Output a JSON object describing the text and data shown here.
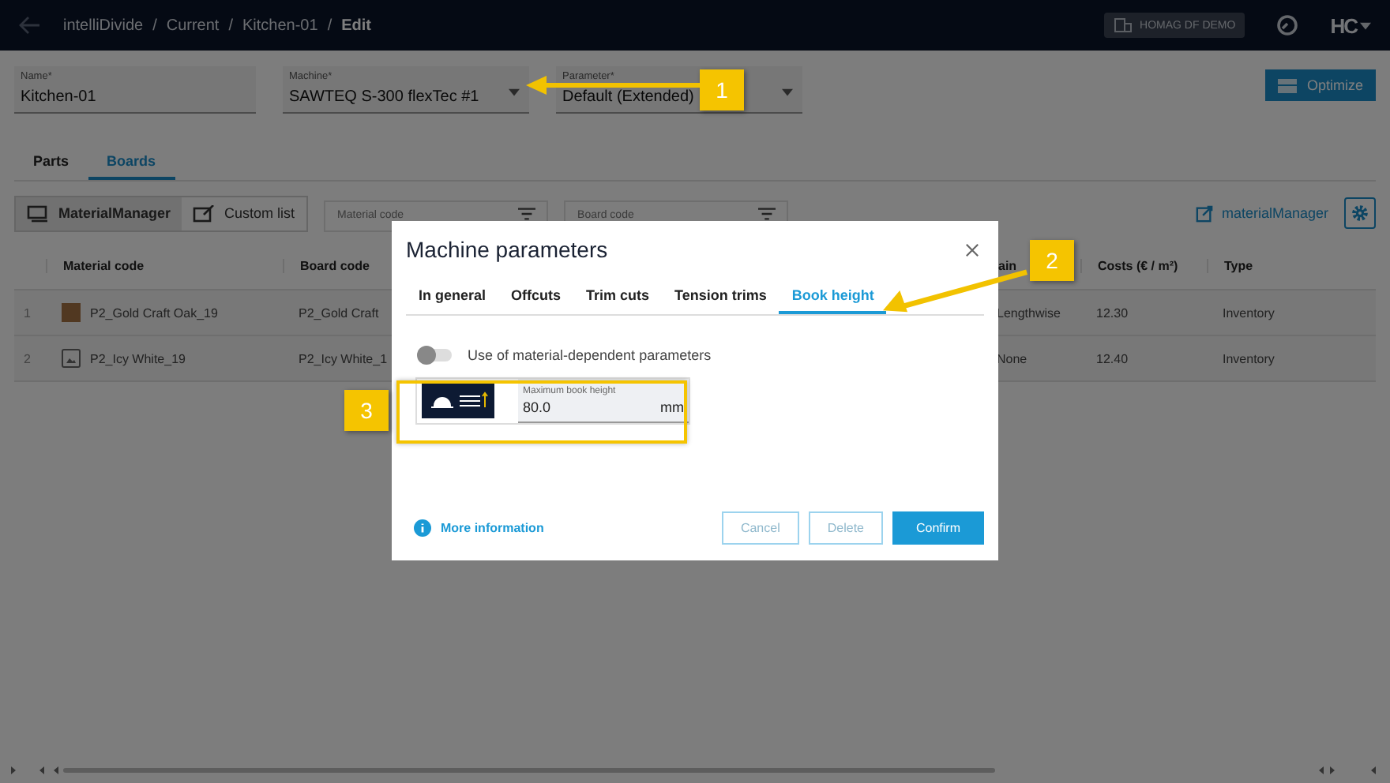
{
  "top_bar": {
    "breadcrumbs": [
      "intelliDivide",
      "Current",
      "Kitchen-01",
      "Edit"
    ],
    "separator": "/",
    "account_badge": "HOMAG DF DEMO",
    "logo": "HC"
  },
  "form": {
    "fields": [
      {
        "label": "Name*",
        "value": "Kitchen-01",
        "kind": "text"
      },
      {
        "label": "Machine*",
        "value": "SAWTEQ S-300 flexTec #1",
        "kind": "dropdown"
      },
      {
        "label": "Parameter*",
        "value": "Default (Extended)",
        "kind": "dropdown"
      }
    ],
    "optimize_button": "Optimize"
  },
  "tabs": [
    {
      "label": "Parts",
      "selected": false
    },
    {
      "label": "Boards",
      "selected": true
    }
  ],
  "toolbar": {
    "sources": [
      {
        "label": "MaterialManager",
        "selected": true,
        "kind": "stack"
      },
      {
        "label": "Custom list",
        "selected": false,
        "kind": "edit"
      }
    ],
    "filters": [
      {
        "placeholder": "Material code"
      },
      {
        "placeholder": "Board code"
      }
    ],
    "link": "materialManager"
  },
  "table": {
    "columns": [
      "Material code",
      "Board code",
      "ain",
      "Costs (€ / m²)",
      "Type"
    ],
    "rows": [
      {
        "index": "1",
        "material": "P2_Gold Craft Oak_19",
        "kind": "wood",
        "board": "P2_Gold Craft",
        "grain": "Lengthwise",
        "cost": "12.30",
        "type": "Inventory"
      },
      {
        "index": "2",
        "material": "P2_Icy White_19",
        "kind": "image",
        "board": "P2_Icy White_1",
        "grain": "None",
        "cost": "12.40",
        "type": "Inventory"
      }
    ]
  },
  "dialog": {
    "title": "Machine parameters",
    "tabs": [
      {
        "label": "In general",
        "selected": false
      },
      {
        "label": "Offcuts",
        "selected": false
      },
      {
        "label": "Trim cuts",
        "selected": false
      },
      {
        "label": "Tension trims",
        "selected": false
      },
      {
        "label": "Book height",
        "selected": true
      }
    ],
    "toggle": {
      "label": "Use of material-dependent parameters",
      "on": false
    },
    "parameter": {
      "label": "Maximum book height",
      "value": "80.0",
      "unit": "mm"
    },
    "info_link": "More information",
    "buttons": [
      {
        "label": "Cancel",
        "kind": "outline"
      },
      {
        "label": "Delete",
        "kind": "outline"
      },
      {
        "label": "Confirm",
        "kind": "primary"
      }
    ]
  },
  "callouts": [
    {
      "label": "1"
    },
    {
      "label": "2"
    },
    {
      "label": "3"
    }
  ]
}
